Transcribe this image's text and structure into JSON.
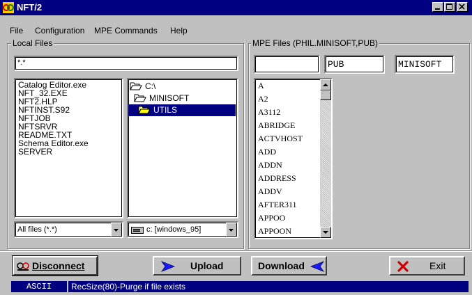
{
  "window": {
    "title": "NFT/2"
  },
  "menu": [
    {
      "label": "File"
    },
    {
      "label": "Configuration"
    },
    {
      "label": "MPE Commands"
    },
    {
      "label": "Help"
    }
  ],
  "local_files": {
    "group_label": "Local Files",
    "filter_value": "*.*",
    "files": [
      "Catalog Editor.exe",
      "NFT_32.EXE",
      "NFT2.HLP",
      "NFTINST.S92",
      "NFTJOB",
      "NFTSRVR",
      "README.TXT",
      "Schema Editor.exe",
      "SERVER"
    ],
    "folders": [
      {
        "label": "C:\\",
        "icon": "open-folder-icon",
        "selected": false
      },
      {
        "label": "MINISOFT",
        "icon": "open-folder-icon",
        "selected": false
      },
      {
        "label": "UTILS",
        "icon": "open-folder-icon",
        "selected": true
      }
    ],
    "file_type_value": "All files (*.*)",
    "drive_value": "c: [windows_95]"
  },
  "mpe_files": {
    "group_label": "MPE Files (PHIL.MINISOFT,PUB)",
    "file_field": "",
    "group_field": "PUB",
    "account_field": "MINISOFT",
    "files": [
      "A",
      "A2",
      "A3112",
      "ABRIDGE",
      "ACTVHOST",
      "ADD",
      "ADDN",
      "ADDRESS",
      "ADDV",
      "AFTER311",
      "APPOO",
      "APPOON"
    ]
  },
  "buttons": {
    "disconnect": "Disconnect",
    "upload": "Upload",
    "download": "Download",
    "exit": "Exit"
  },
  "status": {
    "mode": "ASCII",
    "message": "RecSize(80)-Purge if file exists"
  },
  "colors": {
    "title_bar": "#000080",
    "selection": "#000080",
    "upload_arrow": "#0000ff",
    "download_arrow": "#0000ff",
    "exit_icon": "#cc0000"
  }
}
